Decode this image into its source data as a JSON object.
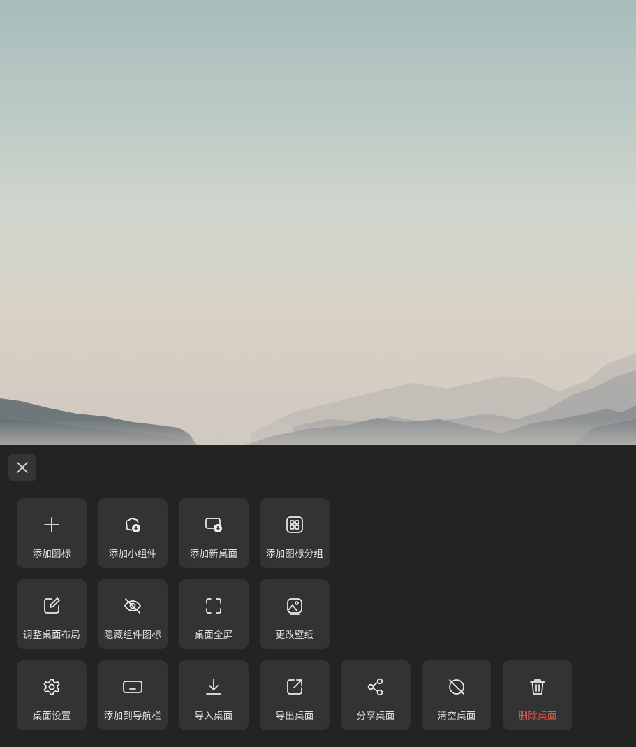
{
  "panel": {
    "close_icon": "close-icon",
    "rows": [
      [
        {
          "label": "添加图标",
          "icon": "plus-icon"
        },
        {
          "label": "添加小组件",
          "icon": "widget-add-icon"
        },
        {
          "label": "添加新桌面",
          "icon": "new-desktop-icon"
        },
        {
          "label": "添加图标分组",
          "icon": "icon-group-icon"
        }
      ],
      [
        {
          "label": "调整桌面布局",
          "icon": "edit-layout-icon"
        },
        {
          "label": "隐藏组件图标",
          "icon": "eye-off-icon"
        },
        {
          "label": "桌面全屏",
          "icon": "fullscreen-icon"
        },
        {
          "label": "更改壁纸",
          "icon": "wallpaper-icon"
        }
      ],
      [
        {
          "label": "桌面设置",
          "icon": "gear-icon"
        },
        {
          "label": "添加到导航栏",
          "icon": "navbar-icon"
        },
        {
          "label": "导入桌面",
          "icon": "import-icon"
        },
        {
          "label": "导出桌面",
          "icon": "export-icon"
        },
        {
          "label": "分享桌面",
          "icon": "share-icon"
        },
        {
          "label": "清空桌面",
          "icon": "clear-icon"
        },
        {
          "label": "删除桌面",
          "icon": "trash-icon",
          "danger_color": "#e0544c"
        }
      ]
    ]
  },
  "colors": {
    "panel_bg": "#232323",
    "tile_bg": "#333333",
    "label": "#e2e2e2",
    "danger": "#e0544c"
  }
}
